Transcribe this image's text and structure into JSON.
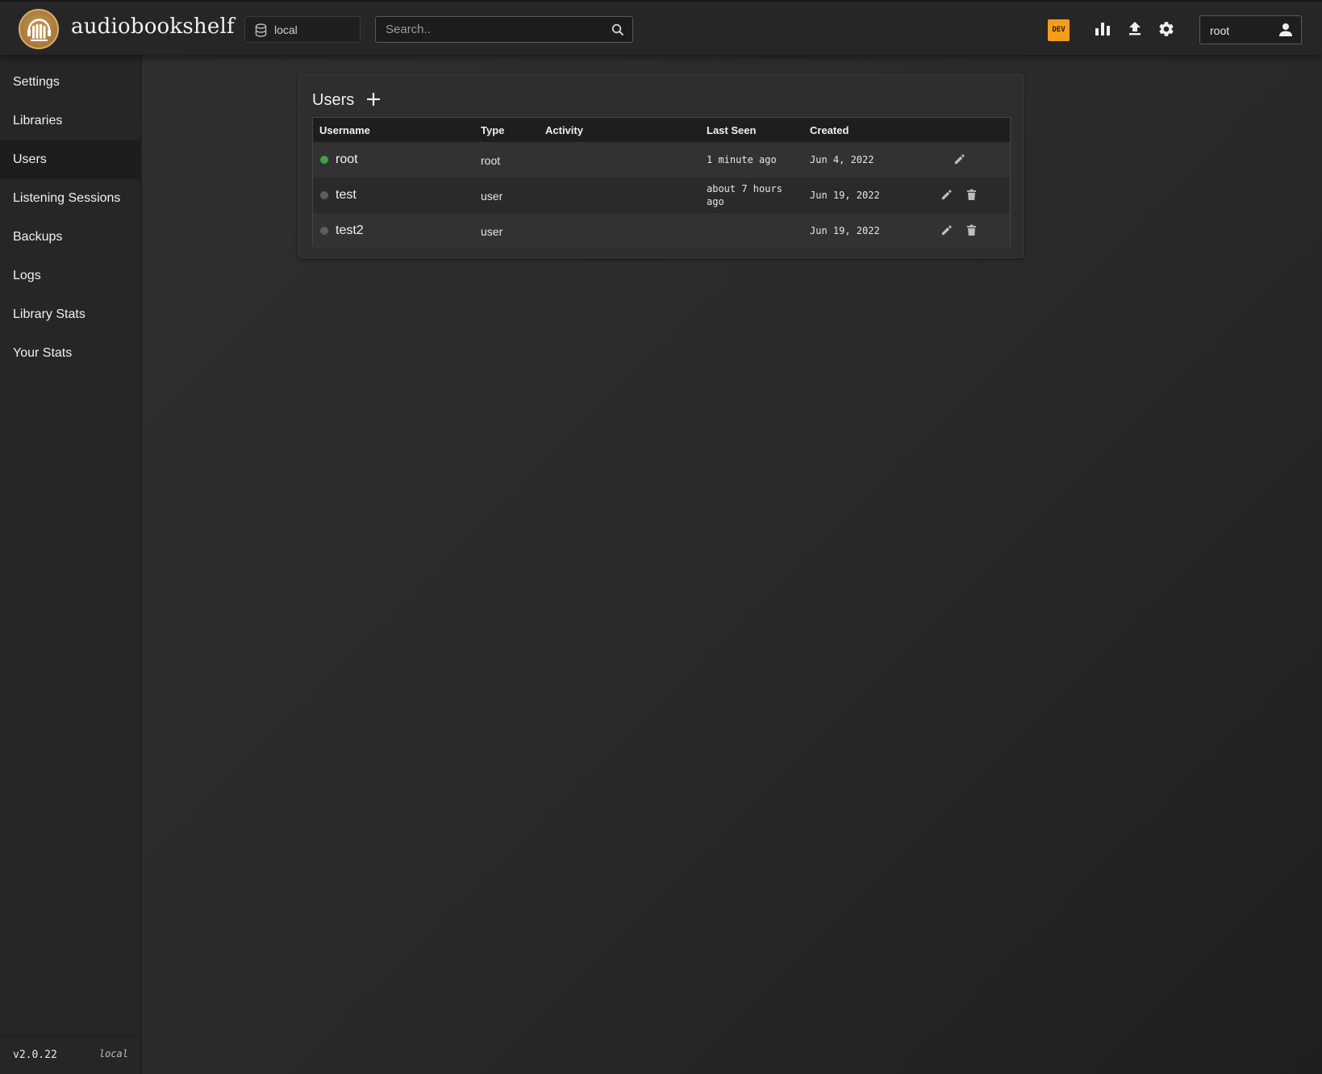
{
  "header": {
    "app_title": "audiobookshelf",
    "library": "local",
    "search_placeholder": "Search..",
    "dev_badge": "DEV",
    "user": "root",
    "accent_color": "#f59d1a"
  },
  "sidebar": {
    "items": [
      {
        "label": "Settings"
      },
      {
        "label": "Libraries"
      },
      {
        "label": "Users",
        "active": true
      },
      {
        "label": "Listening Sessions"
      },
      {
        "label": "Backups"
      },
      {
        "label": "Logs"
      },
      {
        "label": "Library Stats"
      },
      {
        "label": "Your Stats"
      }
    ],
    "version": "v2.0.22",
    "source": "local"
  },
  "users_panel": {
    "title": "Users",
    "columns": [
      "Username",
      "Type",
      "Activity",
      "Last Seen",
      "Created"
    ],
    "rows": [
      {
        "username": "root",
        "type": "root",
        "activity": "",
        "last_seen": "1 minute ago",
        "created": "Jun 4, 2022",
        "online": true,
        "status_color": "#3ea04a"
      },
      {
        "username": "test",
        "type": "user",
        "activity": "",
        "last_seen_line1": "about 7 hours",
        "last_seen_line2": "ago",
        "created": "Jun 19, 2022",
        "online": false,
        "status_color": "#5d5d5d"
      },
      {
        "username": "test2",
        "type": "user",
        "activity": "",
        "last_seen": "",
        "created": "Jun 19, 2022",
        "online": false,
        "status_color": "#5d5d5d"
      }
    ]
  }
}
